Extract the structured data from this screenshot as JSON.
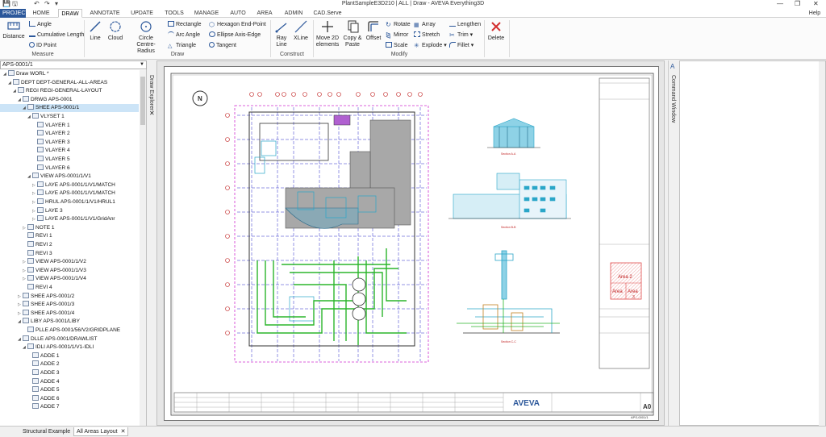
{
  "window": {
    "title": "PlantSampleE3D210 | ALL | Draw - AVEVA Everything3D",
    "help": "Help",
    "controls": [
      "—",
      "❐",
      "✕"
    ]
  },
  "quick_access": [
    "💾",
    "🖫",
    "↶",
    "↷",
    "▾"
  ],
  "tabs": [
    "PROJECT",
    "HOME",
    "DRAW",
    "ANNOTATE",
    "UPDATE",
    "TOOLS",
    "MANAGE",
    "AUTO",
    "AREA",
    "ADMIN",
    "CAD.Serve"
  ],
  "active_tab": "DRAW",
  "ribbon": {
    "measure": {
      "label": "Measure",
      "distance": "Distance",
      "angle": "Angle",
      "cumulative_length": "Cumulative Length",
      "id_point": "ID Point"
    },
    "draw": {
      "label": "Draw",
      "line": "Line",
      "cloud": "Cloud",
      "circle": "Circle Centre-Radius",
      "rectangle": "Rectangle",
      "arc_angle": "Arc Angle",
      "triangle": "Triangle",
      "hexagon": "Hexagon End-Point",
      "ellipse": "Ellipse Axis-Edge",
      "tangent": "Tangent"
    },
    "construct": {
      "label": "Construct",
      "ray_line": "Ray Line",
      "xline": "XLine"
    },
    "modify": {
      "label": "Modify",
      "move2d": "Move 2D elements",
      "copy_paste": "Copy & Paste",
      "offset": "Offset",
      "rotate": "Rotate",
      "mirror": "Mirror",
      "scale": "Scale",
      "array": "Array",
      "stretch": "Stretch",
      "explode": "Explode",
      "lengthen": "Lengthen",
      "trim": "Trim",
      "fillet": "Fillet",
      "delete": "Delete"
    }
  },
  "explorer": {
    "combo_value": "APS-0001/1",
    "vertical_title": "Draw Explorer",
    "tree": [
      {
        "label": "Draw WORL *",
        "toggle": "◢"
      },
      {
        "label": "DEPT DEPT-GENERAL-ALL-AREAS",
        "toggle": "◢"
      },
      {
        "label": "REGI REGI-GENERAL-LAYOUT",
        "toggle": "◢"
      },
      {
        "label": "DRWG APS-0001",
        "toggle": "◢"
      },
      {
        "label": "SHEE APS-0001/1",
        "toggle": "◢"
      },
      {
        "label": "VLYSET 1",
        "toggle": "◢"
      },
      {
        "label": "VLAYER 1",
        "toggle": ""
      },
      {
        "label": "VLAYER 2",
        "toggle": ""
      },
      {
        "label": "VLAYER 3",
        "toggle": ""
      },
      {
        "label": "VLAYER 4",
        "toggle": ""
      },
      {
        "label": "VLAYER 5",
        "toggle": ""
      },
      {
        "label": "VLAYER 6",
        "toggle": ""
      },
      {
        "label": "VIEW APS-0001/1/V1",
        "toggle": "◢"
      },
      {
        "label": "LAYE APS-0001/1/V1/MATCH",
        "toggle": "▷"
      },
      {
        "label": "LAYE APS-0001/1/V1/MATCH",
        "toggle": "▷"
      },
      {
        "label": "HRUL APS-0001/1/V1/HRUL1",
        "toggle": "▷"
      },
      {
        "label": "LAYE 3",
        "toggle": "▷"
      },
      {
        "label": "LAYE APS-0001/1/V1/GridAnr",
        "toggle": "▷"
      },
      {
        "label": "NOTE 1",
        "toggle": "▷"
      },
      {
        "label": "REVI 1",
        "toggle": ""
      },
      {
        "label": "REVI 2",
        "toggle": ""
      },
      {
        "label": "REVI 3",
        "toggle": ""
      },
      {
        "label": "VIEW APS-0001/1/V2",
        "toggle": "▷"
      },
      {
        "label": "VIEW APS-0001/1/V3",
        "toggle": "▷"
      },
      {
        "label": "VIEW APS-0001/1/V4",
        "toggle": "▷"
      },
      {
        "label": "REVI 4",
        "toggle": ""
      },
      {
        "label": "SHEE APS-0001/2",
        "toggle": "▷"
      },
      {
        "label": "SHEE APS-0001/3",
        "toggle": "▷"
      },
      {
        "label": "SHEE APS-0001/4",
        "toggle": "▷"
      },
      {
        "label": "LIBY APS-0001/LIBY",
        "toggle": "◢"
      },
      {
        "label": "PLLE APS-0001/56/V2/GRIDPLANE",
        "toggle": ""
      },
      {
        "label": "DLLE APS-0001/DRAWLIST",
        "toggle": "◢"
      },
      {
        "label": "IDLI APS-0001/1/V1-IDLI",
        "toggle": "◢"
      },
      {
        "label": "ADDE 1",
        "toggle": ""
      },
      {
        "label": "ADDE 2",
        "toggle": ""
      },
      {
        "label": "ADDE 3",
        "toggle": ""
      },
      {
        "label": "ADDE 4",
        "toggle": ""
      },
      {
        "label": "ADDE 5",
        "toggle": ""
      },
      {
        "label": "ADDE 6",
        "toggle": ""
      },
      {
        "label": "ADDE 7",
        "toggle": ""
      }
    ],
    "selected_index": 4
  },
  "drawing": {
    "north": "N",
    "section_labels": [
      "Section A-A",
      "Section B-B",
      "Section C-C"
    ],
    "area_labels": [
      "Area 2",
      "Area",
      "Area",
      "3"
    ],
    "logo": "AVEVA",
    "size": "A0",
    "sheet_no": "APS-0001/1",
    "colors": {
      "pipe_green": "#2bb52b",
      "grid_blue": "#2828c8",
      "equipment_cyan": "#2aa6c8",
      "area_red": "#e04a4a",
      "border_magenta": "#d030d0"
    }
  },
  "command_window": {
    "title": "Command Window"
  },
  "bottom_tabs": [
    "Structural Example",
    "All Areas Layout"
  ],
  "active_bottom_tab": "All Areas Layout"
}
